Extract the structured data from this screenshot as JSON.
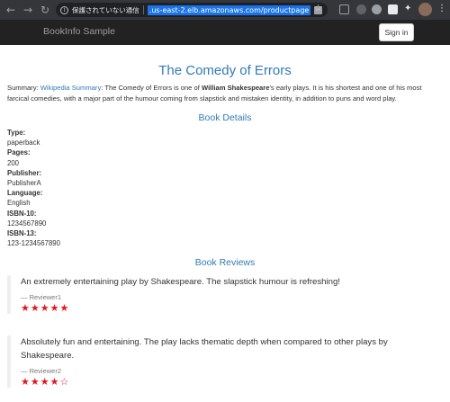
{
  "browser": {
    "security_label": "保護されていない通信",
    "url": ".us-east-2.elb.amazonaws.com/productpage"
  },
  "navbar": {
    "brand": "BookInfo Sample",
    "signin_label": "Sign in"
  },
  "book": {
    "title": "The Comedy of Errors",
    "summary_prefix": "Summary: ",
    "summary_link": "Wikipedia Summary",
    "summary_text_1": ": The Comedy of Errors is one of ",
    "summary_author": "William Shakespeare",
    "summary_text_2": "'s early plays. It is his shortest and one of his most farcical comedies, with a major part of the humour coming from slapstick and mistaken identity, in addition to puns and word play."
  },
  "details": {
    "heading": "Book Details",
    "items": [
      {
        "label": "Type:",
        "value": "paperback"
      },
      {
        "label": "Pages:",
        "value": "200"
      },
      {
        "label": "Publisher:",
        "value": "PublisherA"
      },
      {
        "label": "Language:",
        "value": "English"
      },
      {
        "label": "ISBN-10:",
        "value": "1234567890"
      },
      {
        "label": "ISBN-13:",
        "value": "123-1234567890"
      }
    ]
  },
  "reviews": {
    "heading": "Book Reviews",
    "items": [
      {
        "text": "An extremely entertaining play by Shakespeare. The slapstick humour is refreshing!",
        "reviewer": "— Reviewer1",
        "rating": 5,
        "max_rating": 5
      },
      {
        "text": "Absolutely fun and entertaining. The play lacks thematic depth when compared to other plays by Shakespeare.",
        "reviewer": "— Reviewer2",
        "rating": 4,
        "max_rating": 5
      }
    ]
  },
  "colors": {
    "accent": "#337ab7",
    "star": "#e4151b",
    "navbar_bg": "#222222"
  }
}
